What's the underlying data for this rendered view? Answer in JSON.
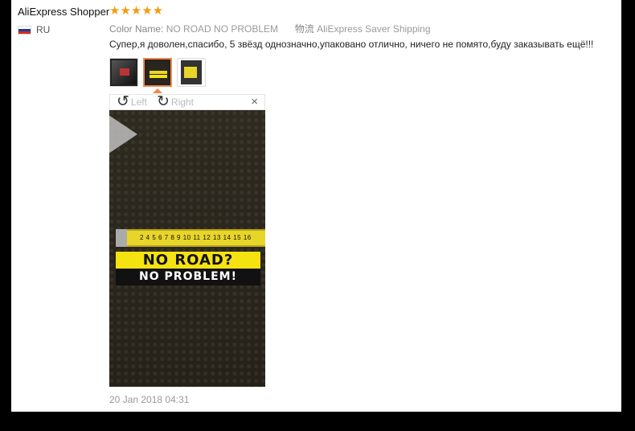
{
  "review": {
    "reviewer_name": "AliExpress Shopper",
    "stars": "★★★★★",
    "country_code": "RU",
    "color_label": "Color Name:",
    "color_value": "NO ROAD NO PROBLEM",
    "shipping_label": "物流",
    "shipping_value": "AliExpress Saver Shipping",
    "comment": "Супер,я доволен,спасибо, 5 звёзд однозначно,упаковано отлично, ничего не помято,буду заказывать ещё!!!",
    "date": "20 Jan 2018 04:31",
    "rating": 5
  },
  "viewer": {
    "rotate_left_label": "Left",
    "rotate_right_label": "Right",
    "rotate_left_icon": "↺",
    "rotate_right_icon": "↻",
    "close_icon": "×"
  },
  "photo": {
    "tape_marks": "2  4  5  6  7  8  9  10 11 12 13 14 15 16",
    "sticker_line1": "NO ROAD?",
    "sticker_line2": "NO PROBLEM!"
  },
  "colors": {
    "star": "#f39c12",
    "active_thumb_border": "#f08a4b",
    "sticker_yellow": "#f5e211"
  }
}
